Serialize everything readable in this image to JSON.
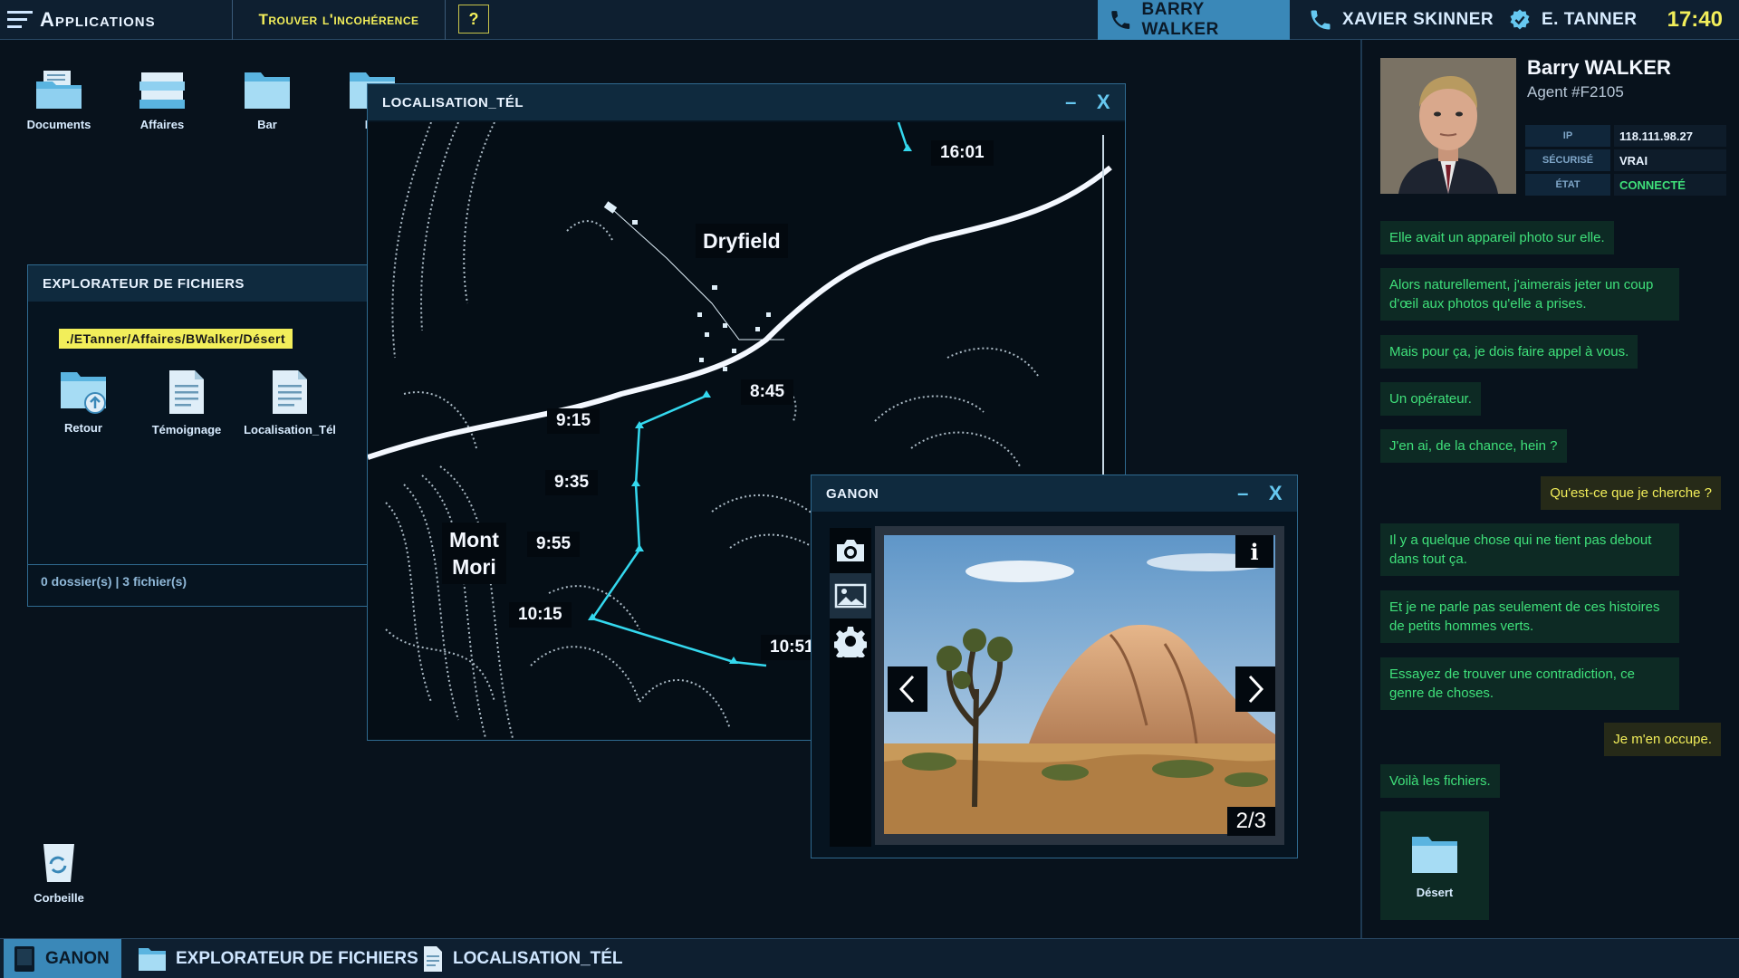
{
  "topbar": {
    "apps_label": "Applications",
    "find_label": "Trouver l'incohérence",
    "help_label": "?",
    "contacts": [
      {
        "name": "BARRY WALKER",
        "icon": "phone-icon",
        "active": true
      },
      {
        "name": "XAVIER SKINNER",
        "icon": "phone-icon",
        "active": false
      },
      {
        "name": "E. TANNER",
        "icon": "badge-icon",
        "active": false
      }
    ],
    "clock": "17:40"
  },
  "desktop": {
    "icons": [
      {
        "label": "Documents",
        "icon": "documents-folder-icon"
      },
      {
        "label": "Affaires",
        "icon": "cases-stack-icon"
      },
      {
        "label": "Bar",
        "icon": "folder-icon"
      },
      {
        "label": "Dé",
        "icon": "folder-icon"
      }
    ],
    "trash_label": "Corbeille"
  },
  "file_explorer": {
    "title": "EXPLORATEUR DE FICHIERS",
    "path": "./ETanner/Affaires/BWalker/Désert",
    "items": [
      {
        "label": "Retour",
        "icon": "folder-upload-icon"
      },
      {
        "label": "Témoignage",
        "icon": "document-icon"
      },
      {
        "label": "Localisation_Tél",
        "icon": "document-icon"
      }
    ],
    "status": "0 dossier(s) | 3 fichier(s)"
  },
  "map_window": {
    "title": "LOCALISATION_TÉL",
    "minimize": "–",
    "close": "X",
    "places": {
      "town": "Dryfield",
      "mountain_line1": "Mont",
      "mountain_line2": "Mori"
    },
    "times": [
      "16:01",
      "8:45",
      "9:15",
      "9:35",
      "9:55",
      "10:15",
      "10:51"
    ]
  },
  "ganon_window": {
    "title": "GANON",
    "minimize": "–",
    "close": "X",
    "tools": [
      "camera-icon",
      "image-icon",
      "settings-gear-icon"
    ],
    "info_label": "i",
    "counter": "2/3"
  },
  "agent": {
    "name": "Barry WALKER",
    "id": "Agent #F2105",
    "fields": [
      {
        "key": "IP",
        "value": "118.111.98.27"
      },
      {
        "key": "SÉCURISÉ",
        "value": "VRAI"
      },
      {
        "key": "ÉTAT",
        "value": "CONNECTÉ"
      }
    ],
    "status_color": "#3fe07a"
  },
  "chat": {
    "messages": [
      {
        "from": "in",
        "text": "Elle avait un appareil photo sur elle."
      },
      {
        "from": "in",
        "text": "Alors naturellement, j'aimerais jeter un coup d'œil aux photos qu'elle a prises."
      },
      {
        "from": "in",
        "text": "Mais pour ça, je dois faire appel à vous."
      },
      {
        "from": "in",
        "text": "Un opérateur."
      },
      {
        "from": "in",
        "text": "J'en ai, de la chance, hein ?"
      },
      {
        "from": "out",
        "text": "Qu'est-ce que je cherche ?"
      },
      {
        "from": "in",
        "text": "Il y a quelque chose qui ne tient pas debout dans tout ça."
      },
      {
        "from": "in",
        "text": "Et je ne parle pas seulement de ces histoires de petits hommes verts."
      },
      {
        "from": "in",
        "text": "Essayez de trouver une contradiction, ce genre de choses."
      },
      {
        "from": "out",
        "text": "Je m'en occupe."
      },
      {
        "from": "in",
        "text": "Voilà les fichiers."
      }
    ],
    "attachment_label": "Désert"
  },
  "taskbar": {
    "items": [
      {
        "label": "GANON",
        "icon": "ganon-icon",
        "active": true
      },
      {
        "label": "EXPLORATEUR DE FICHIERS",
        "icon": "folder-icon",
        "active": false
      },
      {
        "label": "LOCALISATION_TÉL",
        "icon": "document-icon",
        "active": false
      }
    ]
  },
  "colors": {
    "accent_yellow": "#f2ee5a",
    "accent_blue": "#3a88b8",
    "chat_green": "#3fe07a",
    "route_cyan": "#34d8ee"
  }
}
